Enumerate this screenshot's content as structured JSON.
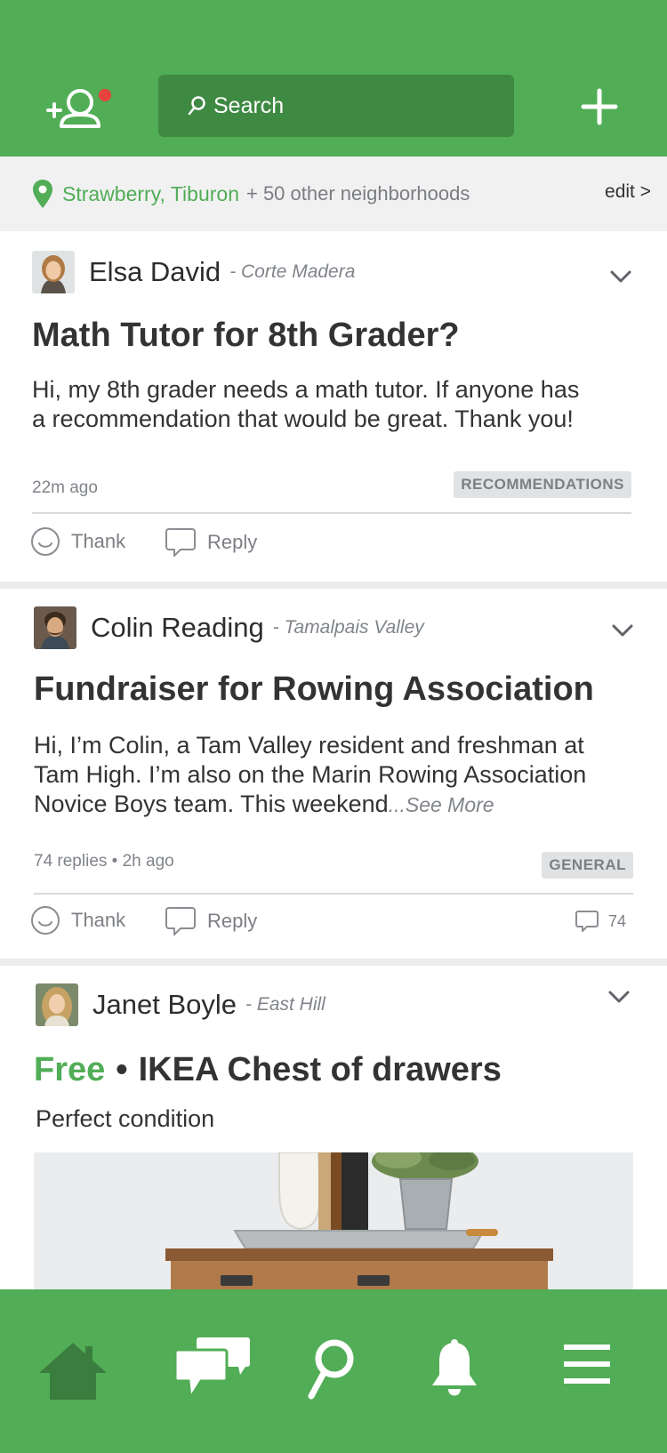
{
  "header": {
    "search_label": "Search"
  },
  "location": {
    "neighborhood": "Strawberry, Tiburon",
    "others": "+ 50 other neighborhoods",
    "edit_label": "edit >"
  },
  "colors": {
    "brand_green": "#51ad56",
    "search_green": "#3f8a43",
    "notification_dot": "#e8423c"
  },
  "posts": [
    {
      "author": "Elsa David",
      "neighborhood": "- Corte Madera",
      "title": "Math Tutor for 8th Grader?",
      "body_line1": "Hi, my 8th grader needs a math tutor. If anyone has",
      "body_line2": "a recommendation that would be great. Thank you!",
      "meta": "22m ago",
      "category": "RECOMMENDATIONS",
      "thank_label": "Thank",
      "reply_label": "Reply"
    },
    {
      "author": "Colin Reading",
      "neighborhood": "- Tamalpais Valley",
      "title": "Fundraiser for Rowing Association",
      "body_line1": "Hi, I’m Colin, a Tam Valley resident and freshman at",
      "body_line2": "Tam High. I’m also on the Marin Rowing Association",
      "body_line3": "Novice Boys team. This weekend",
      "see_more": "...See More",
      "meta": "74 replies • 2h ago",
      "category": "GENERAL",
      "thank_label": "Thank",
      "reply_label": "Reply",
      "reply_count": "74"
    },
    {
      "author": "Janet Boyle",
      "neighborhood": "- East Hill",
      "price": "Free",
      "bullet": "•",
      "title": "IKEA Chest of drawers",
      "body": "Perfect condition"
    }
  ],
  "tabbar": {
    "icons": [
      "home-icon",
      "messages-icon",
      "search-icon",
      "notifications-icon",
      "menu-icon"
    ]
  }
}
